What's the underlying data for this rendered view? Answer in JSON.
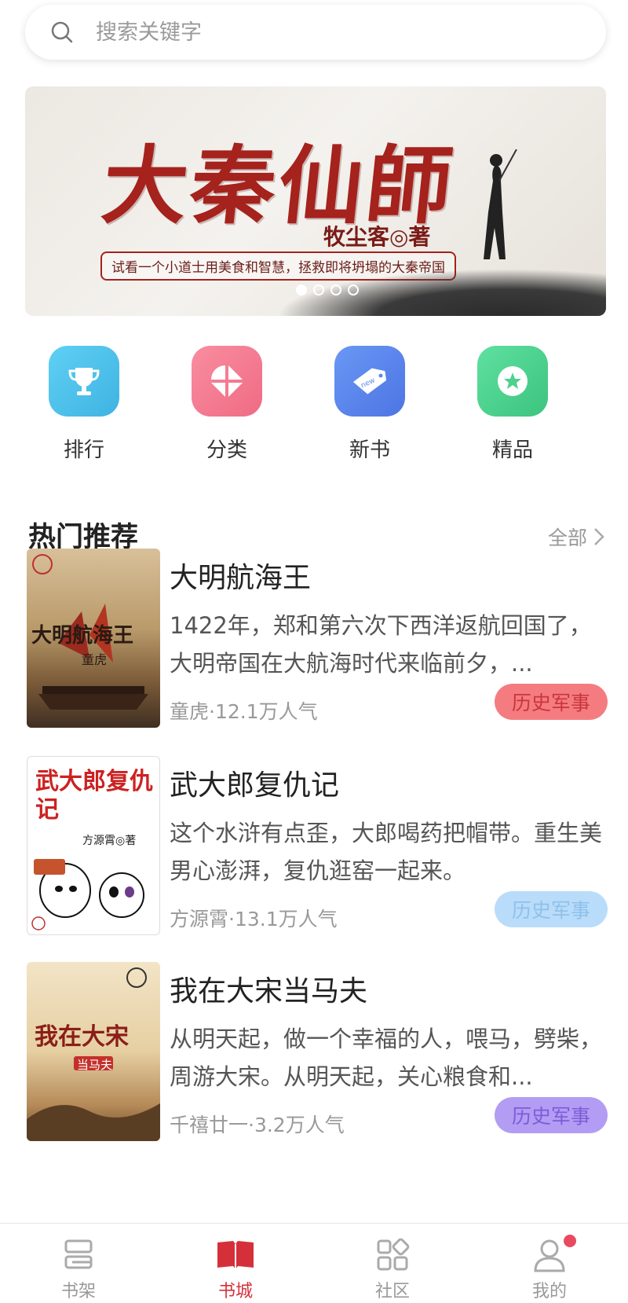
{
  "search": {
    "placeholder": "搜索关键字"
  },
  "banner": {
    "title": "大秦仙師",
    "author": "牧尘客◎著",
    "tagline": "试看一个小道士用美食和智慧，拯救即将坍塌的大秦帝国",
    "dots_total": 4,
    "dots_active_index": 0
  },
  "categories": [
    {
      "label": "排行",
      "icon": "trophy-icon",
      "color": "#4fc3ea"
    },
    {
      "label": "分类",
      "icon": "category-icon",
      "color": "#f0708a"
    },
    {
      "label": "新书",
      "icon": "new-tag-icon",
      "color": "#5b87ef"
    },
    {
      "label": "精品",
      "icon": "star-icon",
      "color": "#4fd18e"
    }
  ],
  "section": {
    "title": "热门推荐",
    "more_label": "全部"
  },
  "books": [
    {
      "title": "大明航海王",
      "desc": "1422年，郑和第六次下西洋返航回国了，大明帝国在大航海时代来临前夕，...",
      "meta": "童虎·12.1万人气",
      "tag": "历史军事",
      "tag_bg": "#f47c80",
      "tag_fg": "#c9363c",
      "cover_text": "大明航海王",
      "cover_author": "童虎"
    },
    {
      "title": "武大郎复仇记",
      "desc": "这个水浒有点歪，大郎喝药把帽带。重生美男心澎湃，复仇逛窑一起来。",
      "meta": "方源霄·13.1万人气",
      "tag": "历史军事",
      "tag_bg": "#b9dcfa",
      "tag_fg": "#8fc1ea",
      "cover_text": "武大郎复仇记",
      "cover_author": "方源霄◎著"
    },
    {
      "title": "我在大宋当马夫",
      "desc": "从明天起，做一个幸福的人，喂马，劈柴，周游大宋。从明天起，关心粮食和...",
      "meta": "千禧廿一·3.2万人气",
      "tag": "历史军事",
      "tag_bg": "#b39cf3",
      "tag_fg": "#7b5dd8",
      "cover_text": "我在大宋",
      "cover_author": "当马夫"
    }
  ],
  "tabs": [
    {
      "label": "书架",
      "icon": "bookshelf-icon",
      "active": false
    },
    {
      "label": "书城",
      "icon": "book-open-icon",
      "active": true
    },
    {
      "label": "社区",
      "icon": "community-grid-icon",
      "active": false
    },
    {
      "label": "我的",
      "icon": "profile-icon",
      "active": false
    }
  ],
  "colors": {
    "accent": "#d5303a"
  }
}
